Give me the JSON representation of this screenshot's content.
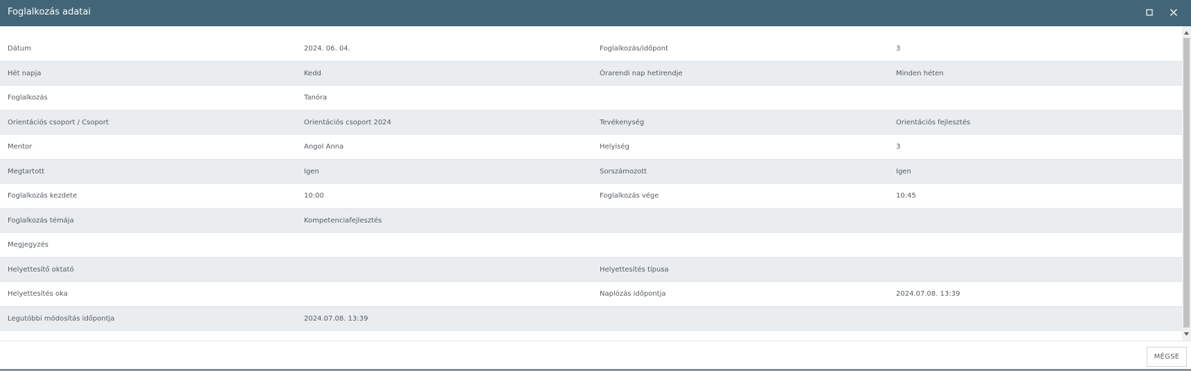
{
  "window": {
    "title": "Foglalkozás adatai",
    "maximize_icon": "maximize-icon",
    "close_icon": "close-icon"
  },
  "colors": {
    "titlebar": "#426678",
    "row_shaded": "#e9edf0",
    "text": "#555b60"
  },
  "rows": [
    {
      "label1": "Dátum",
      "value1": "2024. 06. 04.",
      "label2": "Foglalkozás/időpont",
      "value2": "3"
    },
    {
      "label1": "Hét napja",
      "value1": "Kedd",
      "label2": "Órarendi nap hetirendje",
      "value2": "Minden héten"
    },
    {
      "label1": "Foglalkozás",
      "value1": "Tanóra",
      "label2": "",
      "value2": ""
    },
    {
      "label1": "Orientációs csoport / Csoport",
      "value1": "Orientációs csoport 2024",
      "label2": "Tevékenység",
      "value2": "Orientációs fejlesztés"
    },
    {
      "label1": "Mentor",
      "value1": "Angol Anna",
      "label2": "Helyiség",
      "value2": "3"
    },
    {
      "label1": "Megtartott",
      "value1": "Igen",
      "label2": "Sorszámozott",
      "value2": "Igen"
    },
    {
      "label1": "Foglalkozás kezdete",
      "value1": "10:00",
      "label2": "Foglalkozás vége",
      "value2": "10:45"
    },
    {
      "label1": "Foglalkozás témája",
      "value1": "Kompetenciafejlesztés",
      "label2": "",
      "value2": ""
    },
    {
      "label1": "Megjegyzés",
      "value1": "",
      "label2": "",
      "value2": ""
    },
    {
      "label1": "Helyettesítő oktató",
      "value1": "",
      "label2": "Helyettesítés típusa",
      "value2": ""
    },
    {
      "label1": "Helyettesítés oka",
      "value1": "",
      "label2": "Naplózás időpontja",
      "value2": "2024.07.08. 13:39"
    },
    {
      "label1": "Legutóbbi módosítás időpontja",
      "value1": "2024.07.08. 13:39",
      "label2": "",
      "value2": ""
    }
  ],
  "footer": {
    "cancel_label": "MÉGSE"
  }
}
